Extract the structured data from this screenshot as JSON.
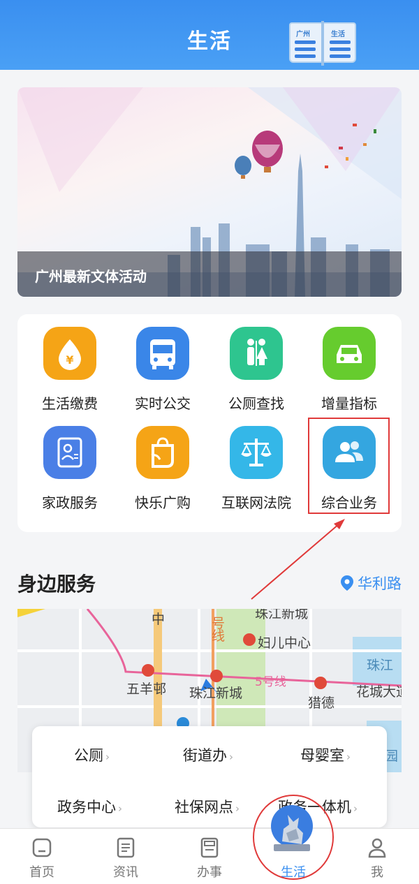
{
  "header": {
    "title": "生活",
    "book_left": "广州",
    "book_right": "生活"
  },
  "banner": {
    "caption": "广州最新文体活动"
  },
  "services": [
    {
      "label": "生活缴费",
      "icon": "yen-drop-icon",
      "color": "#f5a416"
    },
    {
      "label": "实时公交",
      "icon": "bus-icon",
      "color": "#3a86e8"
    },
    {
      "label": "公厕查找",
      "icon": "restroom-icon",
      "color": "#2ec58f"
    },
    {
      "label": "增量指标",
      "icon": "car-icon",
      "color": "#66cc2e"
    },
    {
      "label": "家政服务",
      "icon": "id-card-icon",
      "color": "#4a7fe6"
    },
    {
      "label": "快乐广购",
      "icon": "shopping-bag-icon",
      "color": "#f5a416"
    },
    {
      "label": "互联网法院",
      "icon": "scales-icon",
      "color": "#34b7e8"
    },
    {
      "label": "综合业务",
      "icon": "users-icon",
      "color": "#34a6e0"
    }
  ],
  "nearby": {
    "title": "身边服务",
    "location": "华利路",
    "map_labels": [
      "中",
      "号",
      "线",
      "珠江新城",
      "妇儿中心",
      "珠江",
      "五羊邨",
      "珠江新城",
      "5号线",
      "猎德",
      "花城大道",
      "园"
    ],
    "categories": [
      "公厕",
      "街道办",
      "母婴室",
      "政务中心",
      "社保网点",
      "政务一体机"
    ]
  },
  "nav": {
    "items": [
      {
        "label": "首页",
        "icon": "home-icon"
      },
      {
        "label": "资讯",
        "icon": "news-icon"
      },
      {
        "label": "办事",
        "icon": "document-icon"
      },
      {
        "label": "生活",
        "icon": "goat-statue-icon"
      },
      {
        "label": "我",
        "icon": "person-icon"
      }
    ],
    "active": "生活"
  },
  "colors": {
    "primary": "#3a8ff0",
    "annotation": "#e03a3a"
  }
}
